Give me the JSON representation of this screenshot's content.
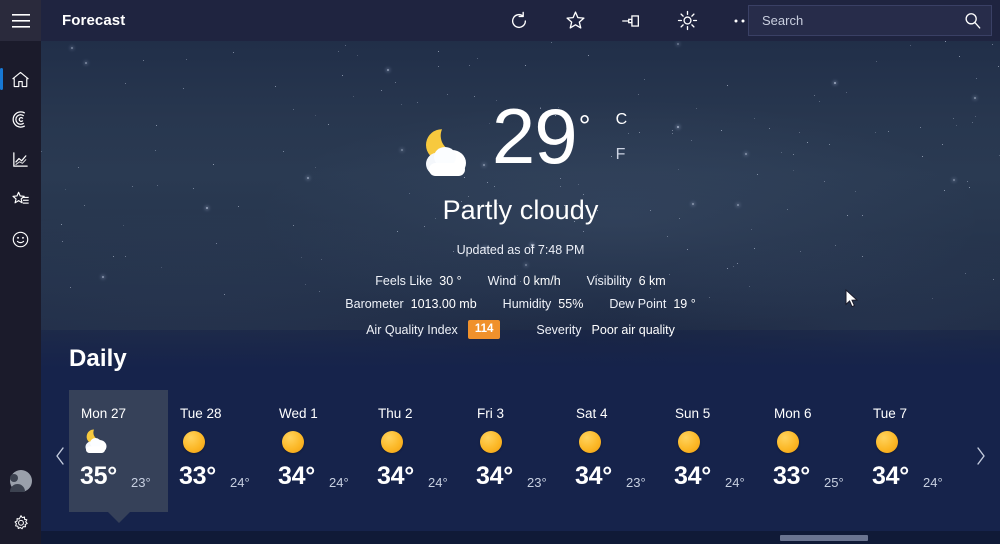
{
  "titlebar": {
    "app_title": "Forecast",
    "menu_icon": "hamburger-menu-icon",
    "icons": [
      {
        "name": "refresh-icon",
        "label": "Refresh"
      },
      {
        "name": "favorite-star-icon",
        "label": "Add to favorites"
      },
      {
        "name": "pin-icon",
        "label": "Pin"
      },
      {
        "name": "brightness-icon",
        "label": "Brightness"
      },
      {
        "name": "more-options-icon",
        "label": "More"
      }
    ],
    "search": {
      "placeholder": "Search",
      "value": "",
      "icon": "search-icon"
    }
  },
  "sidebar": {
    "items": [
      {
        "name": "home",
        "icon": "home-icon",
        "label": "Home",
        "active": true
      },
      {
        "name": "maps",
        "icon": "radar-maps-icon",
        "label": "Maps",
        "active": false
      },
      {
        "name": "historical",
        "icon": "trend-chart-icon",
        "label": "Historical Weather",
        "active": false
      },
      {
        "name": "favorites",
        "icon": "favorites-list-icon",
        "label": "Favorites",
        "active": false
      },
      {
        "name": "feedback",
        "icon": "smiley-face-icon",
        "label": "Send feedback",
        "active": false
      }
    ],
    "bottom_items": [
      {
        "name": "account",
        "icon": "account-avatar-icon",
        "label": "Account"
      },
      {
        "name": "settings",
        "icon": "gear-icon",
        "label": "Settings"
      }
    ]
  },
  "current": {
    "condition_icon": "moon-behind-cloud-icon",
    "temperature": "29",
    "degree_symbol": "°",
    "unit_celsius": "C",
    "unit_fahrenheit": "F",
    "condition_text": "Partly cloudy",
    "updated_text": "Updated as of 7:48 PM",
    "details_row1": [
      {
        "label": "Feels Like",
        "value": "30 °"
      },
      {
        "label": "Wind",
        "value": "0 km/h"
      },
      {
        "label": "Visibility",
        "value": "6 km"
      }
    ],
    "details_row2": [
      {
        "label": "Barometer",
        "value": "1013.00 mb"
      },
      {
        "label": "Humidity",
        "value": "55%"
      },
      {
        "label": "Dew Point",
        "value": "19 °"
      }
    ],
    "aqi": {
      "label": "Air Quality Index",
      "value": "114",
      "badge_color": "#f0912c",
      "severity_label": "Severity",
      "severity_value": "Poor air quality"
    }
  },
  "daily": {
    "heading": "Daily",
    "prev_icon": "chevron-left-icon",
    "next_icon": "chevron-right-icon",
    "days": [
      {
        "day": "Mon 27",
        "icon": "moon-behind-cloud-icon",
        "high": "35°",
        "low": "23°",
        "selected": true
      },
      {
        "day": "Tue 28",
        "icon": "sunny-icon",
        "high": "33°",
        "low": "24°",
        "selected": false
      },
      {
        "day": "Wed 1",
        "icon": "sunny-icon",
        "high": "34°",
        "low": "24°",
        "selected": false
      },
      {
        "day": "Thu 2",
        "icon": "sunny-icon",
        "high": "34°",
        "low": "24°",
        "selected": false
      },
      {
        "day": "Fri 3",
        "icon": "sunny-icon",
        "high": "34°",
        "low": "23°",
        "selected": false
      },
      {
        "day": "Sat 4",
        "icon": "sunny-icon",
        "high": "34°",
        "low": "23°",
        "selected": false
      },
      {
        "day": "Sun 5",
        "icon": "sunny-icon",
        "high": "34°",
        "low": "24°",
        "selected": false
      },
      {
        "day": "Mon 6",
        "icon": "sunny-icon",
        "high": "33°",
        "low": "25°",
        "selected": false
      },
      {
        "day": "Tue 7",
        "icon": "sunny-icon",
        "high": "34°",
        "low": "24°",
        "selected": false
      }
    ]
  },
  "colors": {
    "accent": "#1778d4",
    "titlebar_bg": "#1f2440",
    "rail_bg": "#1b1b2b",
    "selected_card": "#364159",
    "aqi_orange": "#f0912c",
    "sun_yellow": "#fcb827"
  }
}
